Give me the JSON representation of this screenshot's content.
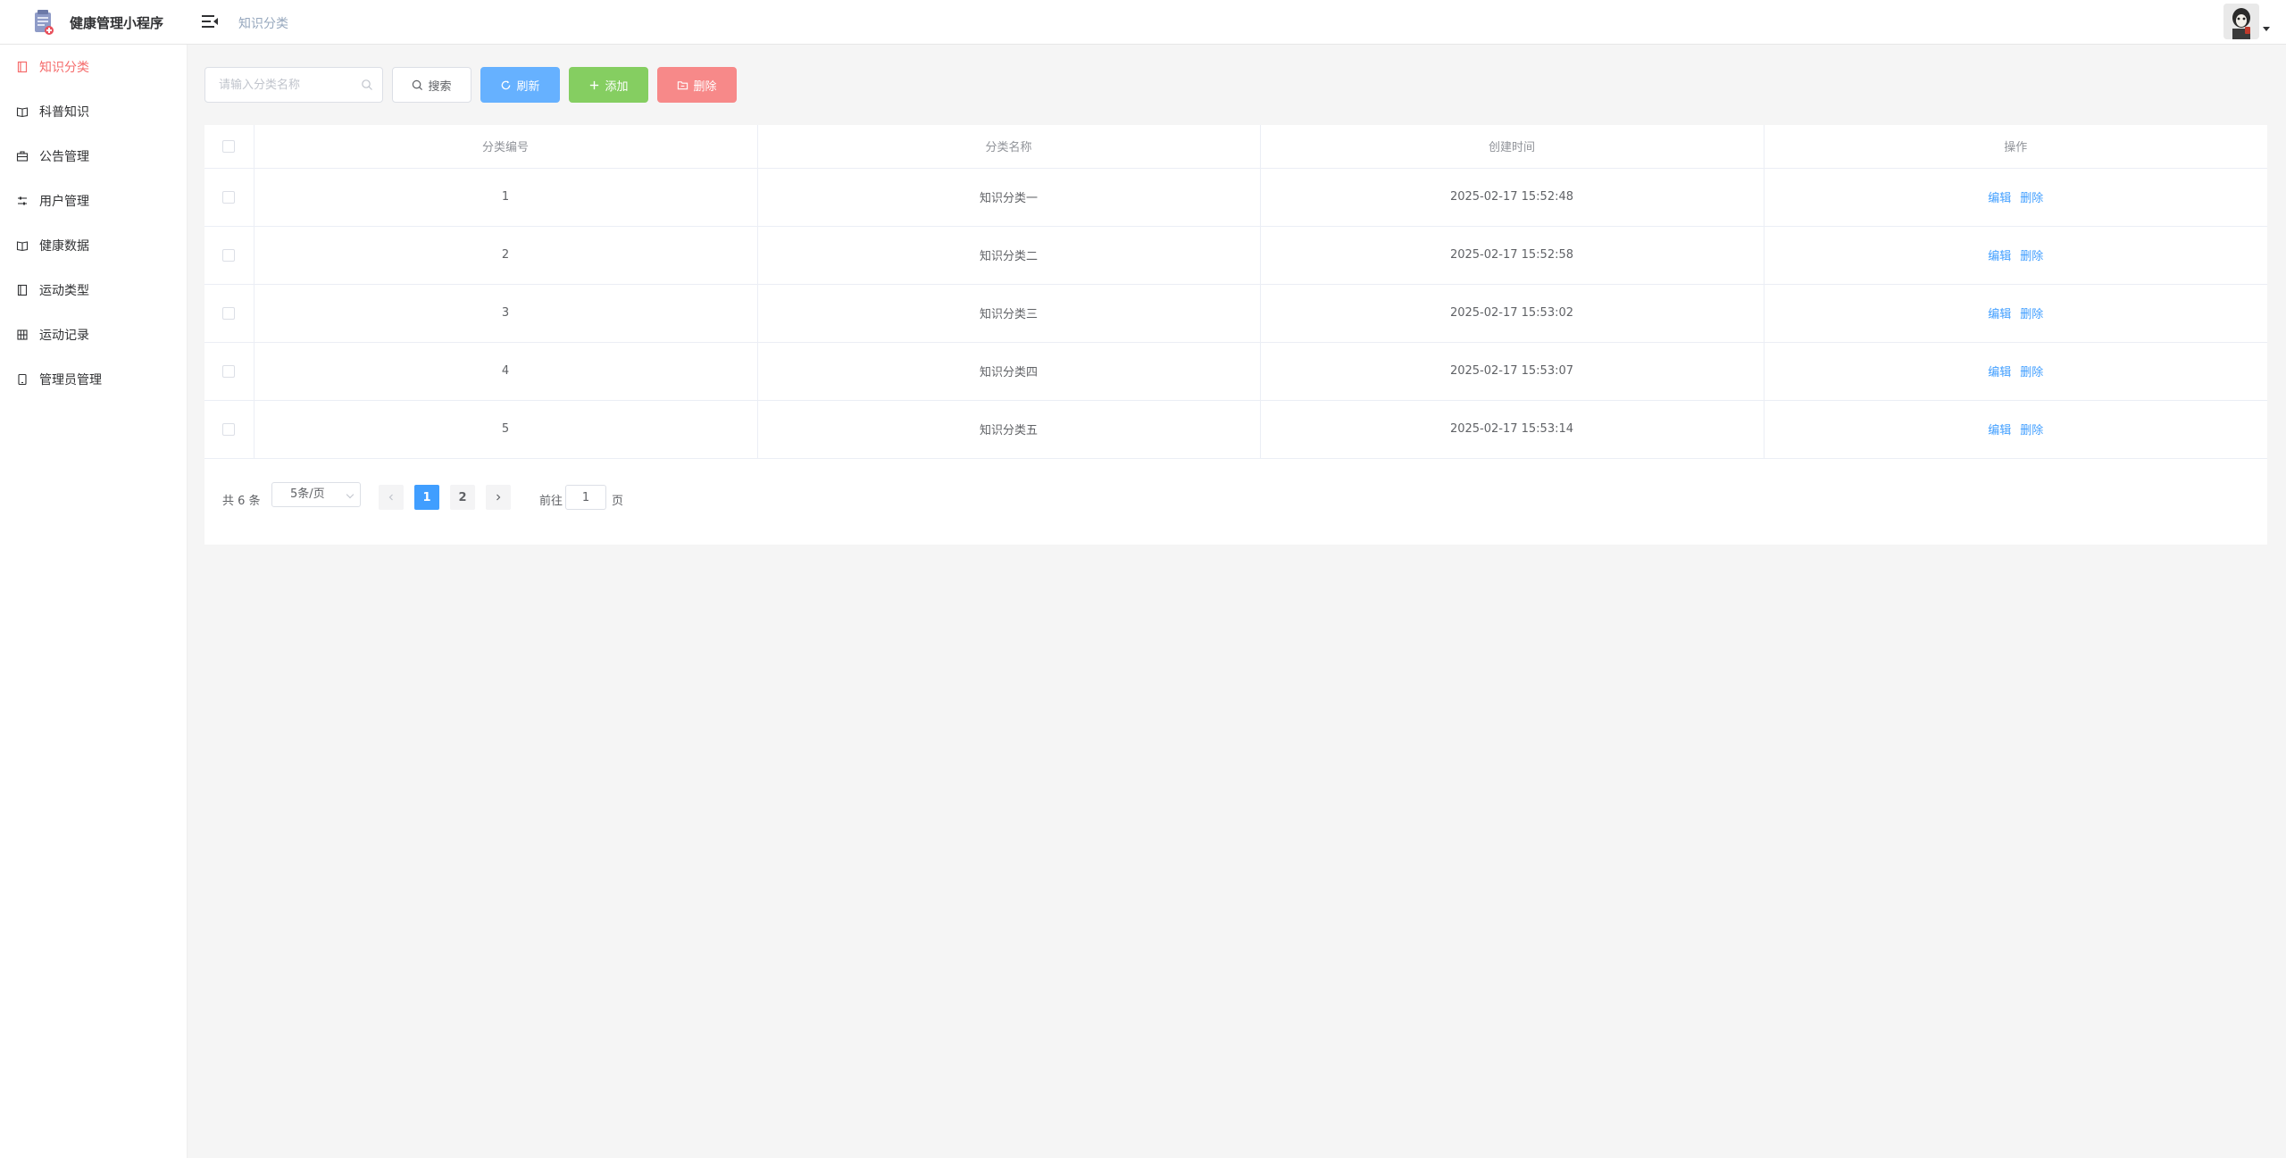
{
  "header": {
    "app_title": "健康管理小程序",
    "breadcrumb": "知识分类"
  },
  "sidebar": {
    "items": [
      {
        "label": "知识分类",
        "icon": "document-icon",
        "active": true
      },
      {
        "label": "科普知识",
        "icon": "book-icon",
        "active": false
      },
      {
        "label": "公告管理",
        "icon": "briefcase-icon",
        "active": false
      },
      {
        "label": "用户管理",
        "icon": "sliders-icon",
        "active": false
      },
      {
        "label": "健康数据",
        "icon": "book-icon",
        "active": false
      },
      {
        "label": "运动类型",
        "icon": "notebook-icon",
        "active": false
      },
      {
        "label": "运动记录",
        "icon": "grid-icon",
        "active": false
      },
      {
        "label": "管理员管理",
        "icon": "tablet-icon",
        "active": false
      }
    ]
  },
  "toolbar": {
    "search_placeholder": "请输入分类名称",
    "search_label": "搜索",
    "refresh_label": "刷新",
    "add_label": "添加",
    "delete_label": "删除"
  },
  "table": {
    "columns": [
      "分类编号",
      "分类名称",
      "创建时间",
      "操作"
    ],
    "rows": [
      {
        "id": "1",
        "name": "知识分类一",
        "created": "2025-02-17 15:52:48"
      },
      {
        "id": "2",
        "name": "知识分类二",
        "created": "2025-02-17 15:52:58"
      },
      {
        "id": "3",
        "name": "知识分类三",
        "created": "2025-02-17 15:53:02"
      },
      {
        "id": "4",
        "name": "知识分类四",
        "created": "2025-02-17 15:53:07"
      },
      {
        "id": "5",
        "name": "知识分类五",
        "created": "2025-02-17 15:53:14"
      }
    ],
    "edit_label": "编辑",
    "delete_label": "删除"
  },
  "pagination": {
    "total": "共 6 条",
    "page_size": "5条/页",
    "pages": [
      "1",
      "2"
    ],
    "current_page": "1",
    "goto_label": "前往",
    "goto_value": "1",
    "goto_suffix": "页"
  },
  "colors": {
    "primary": "#409eff",
    "success": "#85ce61",
    "danger": "#f78989",
    "active_nav": "#f56c6c"
  }
}
